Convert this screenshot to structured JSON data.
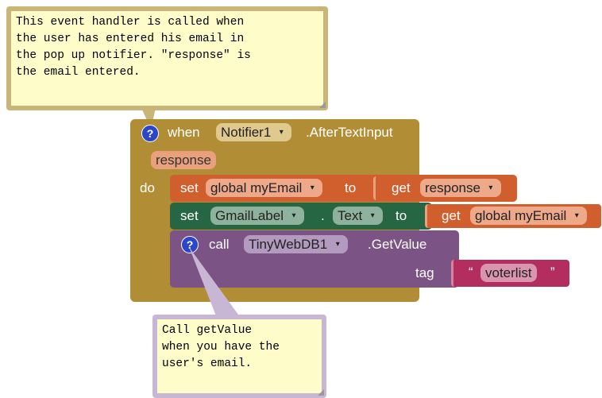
{
  "comment_top": {
    "text": "This event handler is called when\nthe user has entered his email in\nthe pop up notifier. \"response\" is\nthe email entered."
  },
  "event_block": {
    "help_glyph": "?",
    "when": "when",
    "component": "Notifier1",
    "event": ".AfterTextInput",
    "param": "response",
    "do": "do"
  },
  "set_email_block": {
    "set": "set",
    "variable": "global myEmail",
    "to": "to",
    "get": "get",
    "get_var": "response"
  },
  "set_label_block": {
    "set": "set",
    "component": "GmailLabel",
    "dot": ".",
    "property": "Text",
    "to": "to",
    "get": "get",
    "get_var": "global myEmail"
  },
  "call_block": {
    "help_glyph": "?",
    "call": "call",
    "component": "TinyWebDB1",
    "method": ".GetValue",
    "tag_label": "tag",
    "quote_open": "“",
    "tag_value": "voterlist",
    "quote_close": "”"
  },
  "comment_bottom": {
    "text": "Call getValue\nwhen you have the\nuser's email."
  },
  "colors": {
    "event": "#b18e35",
    "variable": "#d05f2d",
    "component_set": "#266643",
    "procedure": "#7c5385",
    "text": "#b32d5e",
    "help": "#2b46c8"
  }
}
